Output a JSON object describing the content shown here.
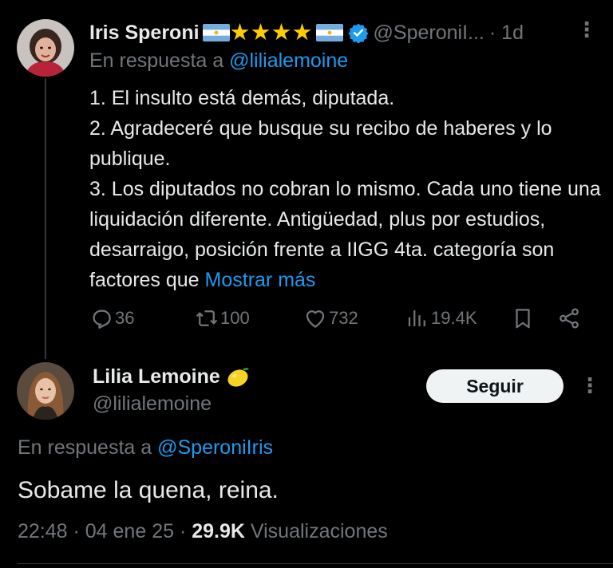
{
  "tweet1": {
    "author_name": "Iris Speroni",
    "author_handle_truncated": "@SperoniI...",
    "time_ago": "· 1d",
    "reply_prefix": "En respuesta a ",
    "reply_handle": "@lilialemoine",
    "body_lines": [
      "1. El insulto está demás, diputada.",
      "2. Agradeceré que busque su recibo de haberes y lo publique.",
      "3. Los diputados no cobran lo mismo. Cada uno tiene una liquidación diferente. Antigüedad, plus por estudios, desarraigo, posición frente a IIGG 4ta. categoría son factores que "
    ],
    "show_more": "Mostrar más",
    "name_decorations": [
      "argentina-flag-icon",
      "star-icon",
      "star-icon",
      "star-icon",
      "star-icon",
      "argentina-flag-icon"
    ],
    "actions": {
      "replies": "36",
      "reposts": "100",
      "likes": "732",
      "views": "19.4K"
    },
    "more_glyph": "⋮"
  },
  "tweet2": {
    "author_name": "Lilia Lemoine",
    "author_handle": "@lilialemoine",
    "follow_label": "Seguir",
    "reply_prefix": "En respuesta a ",
    "reply_handle": "@SperoniIris",
    "text": "Sobame la quena, reina.",
    "time": "22:48 · 04 ene 25 · ",
    "views_count": "29.9K",
    "views_label": " Visualizaciones",
    "more_glyph": "⋮"
  },
  "colors": {
    "background": "#000000",
    "text": "#e7e9ea",
    "muted": "#71767b",
    "link": "#1d9bf0",
    "star": "#ffcc00",
    "button_bg": "#eff3f4"
  }
}
